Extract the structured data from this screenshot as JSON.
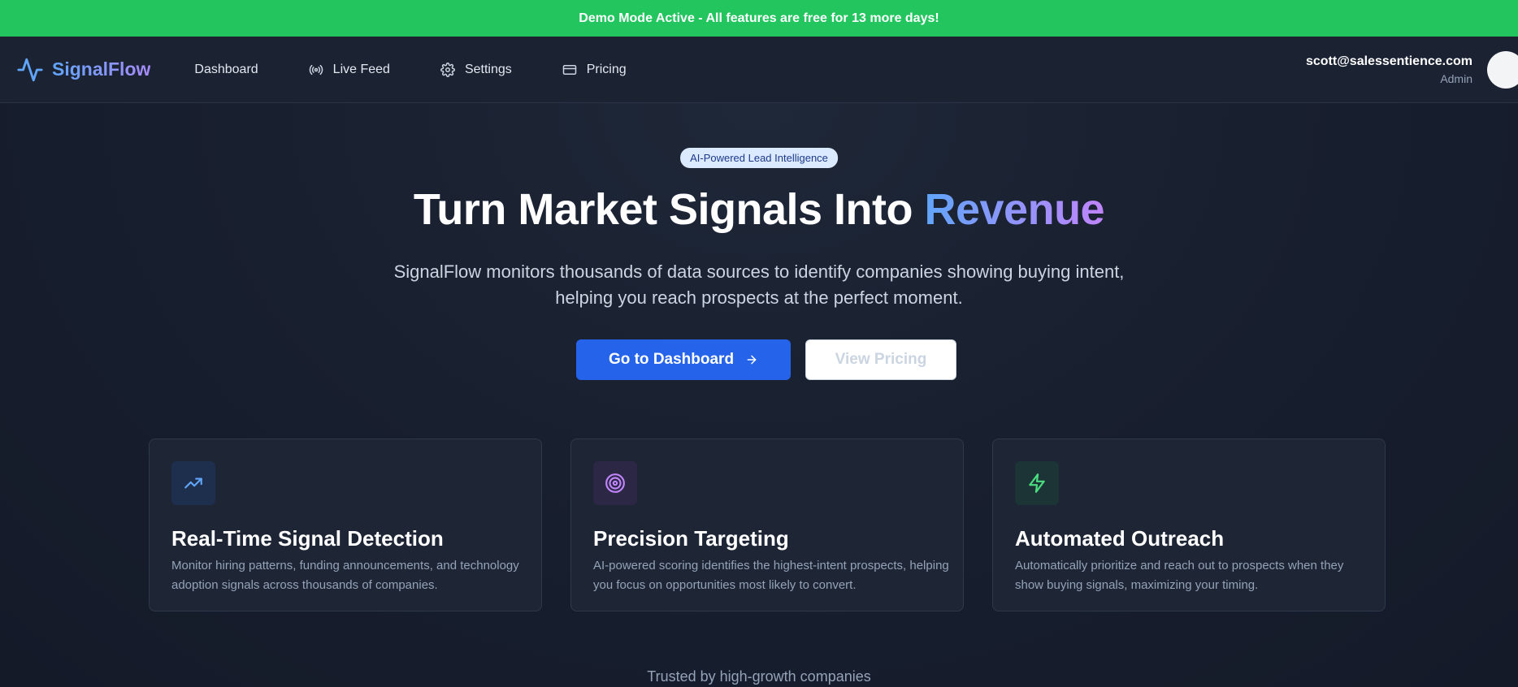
{
  "banner": {
    "text": "Demo Mode Active - All features are free for 13 more days!"
  },
  "brand": {
    "name": "SignalFlow"
  },
  "nav": {
    "dashboard": "Dashboard",
    "live_feed": "Live Feed",
    "settings": "Settings",
    "pricing": "Pricing"
  },
  "user": {
    "email": "scott@salessentience.com",
    "role": "Admin"
  },
  "hero": {
    "badge": "AI-Powered Lead Intelligence",
    "title_main": "Turn Market Signals Into ",
    "title_accent": "Revenue",
    "subtitle": "SignalFlow monitors thousands of data sources to identify companies showing buying intent, helping you reach prospects at the perfect moment.",
    "primary_button": "Go to Dashboard",
    "secondary_button": "View Pricing"
  },
  "features": [
    {
      "title": "Real-Time Signal Detection",
      "description": "Monitor hiring patterns, funding announcements, and technology adoption signals across thousands of companies.",
      "icon": "trending-up-icon",
      "color": "#60a5fa"
    },
    {
      "title": "Precision Targeting",
      "description": "AI-powered scoring identifies the highest-intent prospects, helping you focus on opportunities most likely to convert.",
      "icon": "target-icon",
      "color": "#c084fc"
    },
    {
      "title": "Automated Outreach",
      "description": "Automatically prioritize and reach out to prospects when they show buying signals, maximizing your timing.",
      "icon": "lightning-icon",
      "color": "#4ade80"
    }
  ],
  "trusted": {
    "text": "Trusted by high-growth companies"
  },
  "colors": {
    "banner": "#22c55e",
    "primary": "#2563eb",
    "background": "#161d2e"
  }
}
